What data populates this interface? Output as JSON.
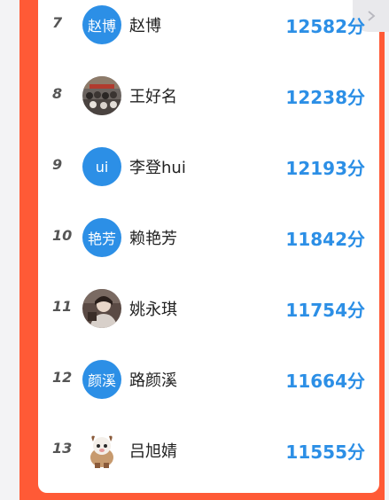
{
  "leaderboard": {
    "rows": [
      {
        "rank": "7",
        "avatar_text": "赵博",
        "avatar_type": "text",
        "name": "赵博",
        "score": "12582分"
      },
      {
        "rank": "8",
        "avatar_text": "",
        "avatar_type": "photo-crowd",
        "name": "王好名",
        "score": "12238分"
      },
      {
        "rank": "9",
        "avatar_text": "ui",
        "avatar_type": "text",
        "name": "李登hui",
        "score": "12193分"
      },
      {
        "rank": "10",
        "avatar_text": "艳芳",
        "avatar_type": "text",
        "name": "赖艳芳",
        "score": "11842分"
      },
      {
        "rank": "11",
        "avatar_text": "",
        "avatar_type": "photo-person",
        "name": "姚永琪",
        "score": "11754分"
      },
      {
        "rank": "12",
        "avatar_text": "颜溪",
        "avatar_type": "text",
        "name": "路颜溪",
        "score": "11664分"
      },
      {
        "rank": "13",
        "avatar_text": "",
        "avatar_type": "photo-cartoon",
        "name": "吕旭婧",
        "score": "11555分"
      }
    ]
  },
  "colors": {
    "frame": "#ff5a36",
    "score": "#2c8fe6",
    "avatar_bg": "#2c8fe6"
  },
  "icons": {
    "corner": "chevron-right-icon"
  }
}
